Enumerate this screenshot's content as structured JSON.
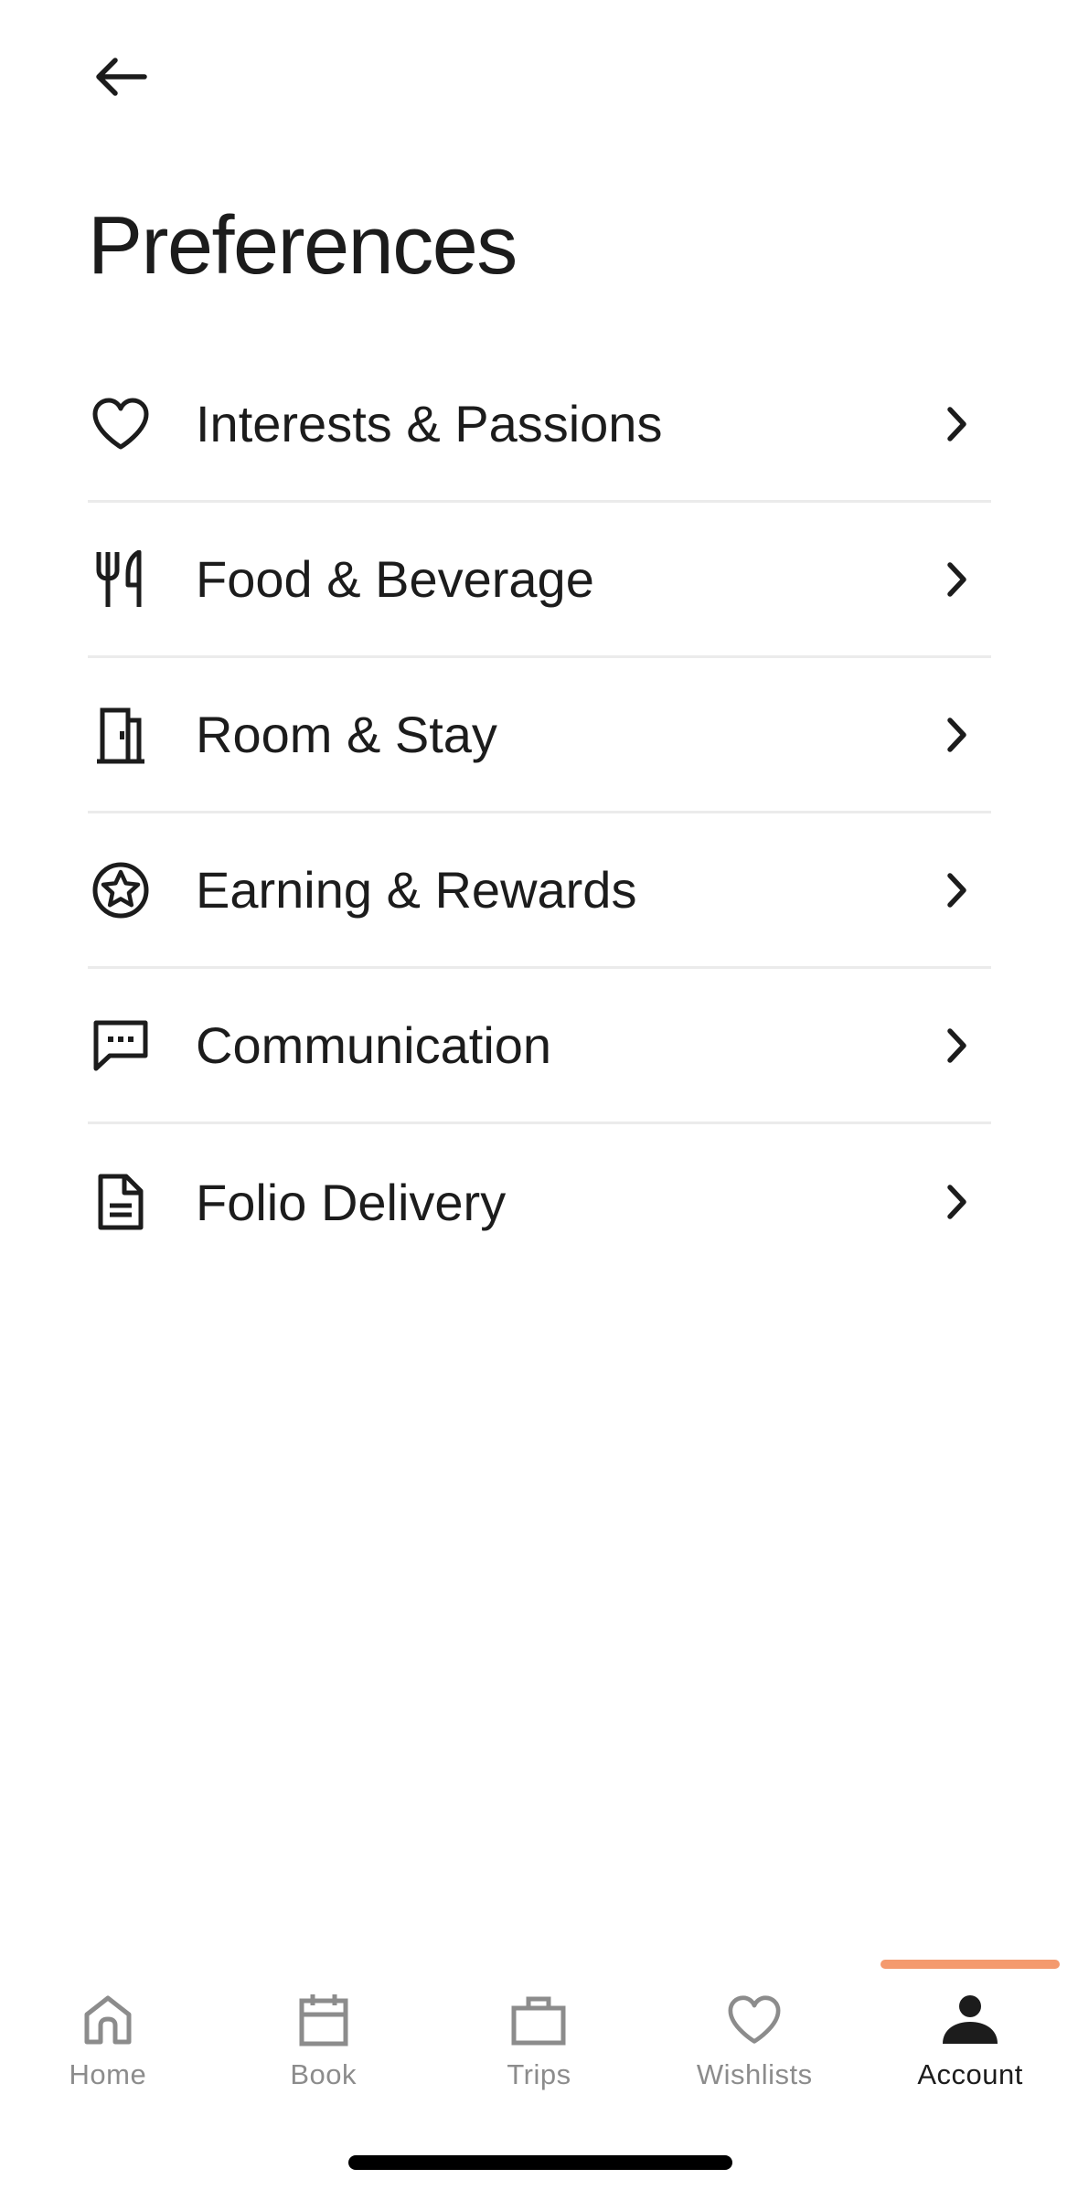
{
  "header": {
    "title": "Preferences"
  },
  "menu": {
    "items": [
      {
        "label": "Interests & Passions",
        "icon": "heart-icon"
      },
      {
        "label": "Food & Beverage",
        "icon": "fork-knife-icon"
      },
      {
        "label": "Room & Stay",
        "icon": "door-icon"
      },
      {
        "label": "Earning & Rewards",
        "icon": "star-circle-icon"
      },
      {
        "label": "Communication",
        "icon": "chat-bubble-icon"
      },
      {
        "label": "Folio Delivery",
        "icon": "document-icon"
      }
    ]
  },
  "nav": {
    "tabs": [
      {
        "label": "Home",
        "icon": "home-icon",
        "active": false
      },
      {
        "label": "Book",
        "icon": "calendar-icon",
        "active": false
      },
      {
        "label": "Trips",
        "icon": "briefcase-icon",
        "active": false
      },
      {
        "label": "Wishlists",
        "icon": "heart-icon",
        "active": false
      },
      {
        "label": "Account",
        "icon": "person-icon",
        "active": true
      }
    ]
  },
  "colors": {
    "text": "#1c1c1c",
    "inactive": "#8c8c8c",
    "divider": "#ebebeb",
    "accent": "#f49a6e"
  }
}
